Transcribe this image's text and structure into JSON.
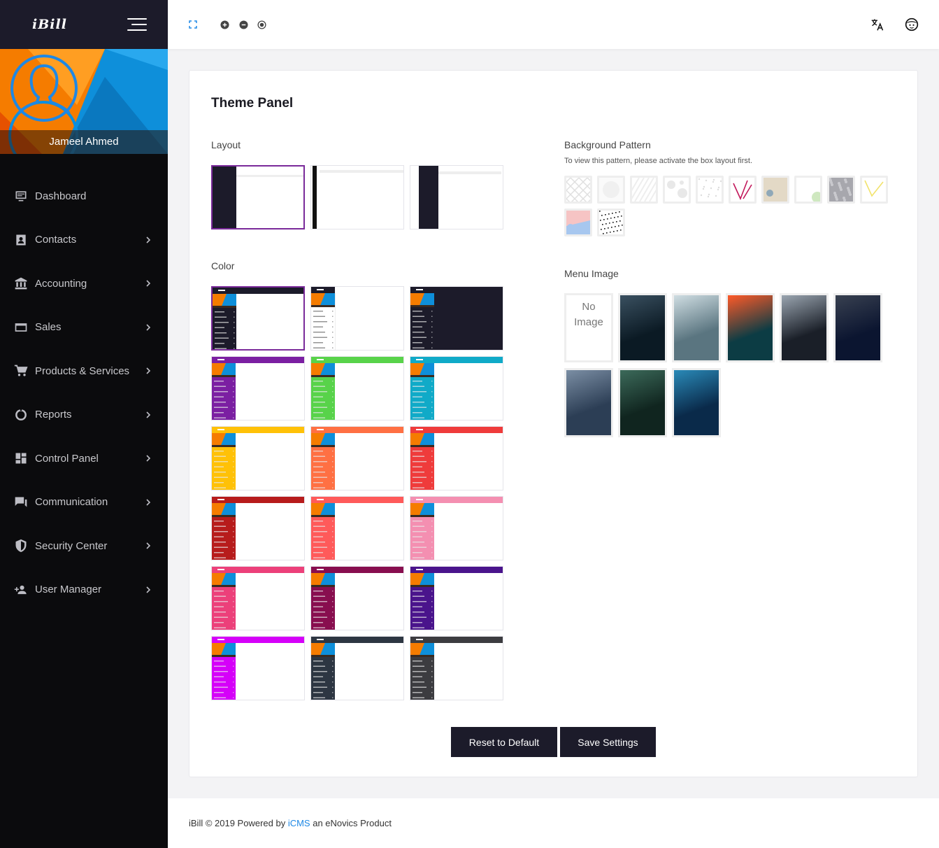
{
  "brand": {
    "logo": "iBill",
    "accent": "#1c1b2a"
  },
  "user": {
    "name": "Jameel Ahmed"
  },
  "menu": [
    {
      "label": "Dashboard",
      "icon": "dashboard-icon",
      "has_children": false
    },
    {
      "label": "Contacts",
      "icon": "contacts-icon",
      "has_children": true
    },
    {
      "label": "Accounting",
      "icon": "bank-icon",
      "has_children": true
    },
    {
      "label": "Sales",
      "icon": "credit-card-icon",
      "has_children": true
    },
    {
      "label": "Products & Services",
      "icon": "cart-icon",
      "has_children": true
    },
    {
      "label": "Reports",
      "icon": "donut-chart-icon",
      "has_children": true
    },
    {
      "label": "Control Panel",
      "icon": "grid-icon",
      "has_children": true
    },
    {
      "label": "Communication",
      "icon": "chat-icon",
      "has_children": true
    },
    {
      "label": "Security Center",
      "icon": "shield-icon",
      "has_children": true
    },
    {
      "label": "User Manager",
      "icon": "add-user-icon",
      "has_children": true
    }
  ],
  "topbar": {
    "icons": [
      "fullscreen-icon",
      "zoom-in-icon",
      "zoom-out-icon",
      "reset-zoom-icon",
      "translate-icon",
      "user-face-icon"
    ]
  },
  "panel": {
    "title": "Theme Panel",
    "layout_label": "Layout",
    "color_label": "Color",
    "bg_pattern_label": "Background Pattern",
    "bg_pattern_note": "To view this pattern, please activate the box layout first.",
    "menu_image_label": "Menu Image",
    "no_image_line1": "No",
    "no_image_line2": "Image",
    "layouts": [
      "full",
      "boxed-light",
      "boxed-dark"
    ],
    "selected_layout": 0,
    "colors": [
      {
        "name": "default",
        "header": "#1c1b2a",
        "side": "#1c1b2a",
        "content": "#ffffff",
        "type": "full"
      },
      {
        "name": "light",
        "header": "#1c1b2a",
        "side": "#ffffff",
        "content": "#ffffff",
        "type": "light"
      },
      {
        "name": "dark",
        "header": "#1c1b2a",
        "side": "#1c1b2a",
        "content": "#1c1b2a",
        "type": "dark"
      },
      {
        "name": "purple",
        "header": "#7b1fa2",
        "side": "#7b1fa2"
      },
      {
        "name": "green",
        "header": "#58d34a",
        "side": "#58d34a"
      },
      {
        "name": "cyan",
        "header": "#10aac8",
        "side": "#10aac8"
      },
      {
        "name": "amber",
        "header": "#ffc107",
        "side": "#ffc107"
      },
      {
        "name": "orange",
        "header": "#ff7043",
        "side": "#ff7043"
      },
      {
        "name": "red",
        "header": "#ef3b3b",
        "side": "#ef3b3b"
      },
      {
        "name": "dark-red",
        "header": "#b71c1c",
        "side": "#b71c1c"
      },
      {
        "name": "coral",
        "header": "#ff5a5a",
        "side": "#ff5a5a"
      },
      {
        "name": "pink",
        "header": "#f48fb1",
        "side": "#f48fb1"
      },
      {
        "name": "rose",
        "header": "#ec407a",
        "side": "#ec407a"
      },
      {
        "name": "maroon",
        "header": "#880e4f",
        "side": "#880e4f"
      },
      {
        "name": "indigo",
        "header": "#4a148c",
        "side": "#4a148c"
      },
      {
        "name": "magenta",
        "header": "#d500f9",
        "side": "#d500f9"
      },
      {
        "name": "slate",
        "header": "#2d3642",
        "side": "#2d3642"
      },
      {
        "name": "graphite",
        "header": "#3c3c40",
        "side": "#3c3c40"
      }
    ],
    "selected_color": 0,
    "patterns": [
      {
        "name": "diamond-pattern",
        "c1": "#e0e0e0",
        "c2": "#ffffff"
      },
      {
        "name": "circle-pattern",
        "c1": "#f0f0f0",
        "c2": "#fafafa"
      },
      {
        "name": "stripe-pattern",
        "c1": "#eeeeee",
        "c2": "#ffffff"
      },
      {
        "name": "blob-pattern",
        "c1": "#e8e8e8",
        "c2": "#ffffff"
      },
      {
        "name": "speck-pattern",
        "c1": "#dddddd",
        "c2": "#ffffff"
      },
      {
        "name": "line-magenta-pattern",
        "c1": "#c2185b",
        "c2": "#ffffff"
      },
      {
        "name": "beige-pattern",
        "c1": "#e3d9c6",
        "c2": "#e3d9c6"
      },
      {
        "name": "green-dot-pattern",
        "c1": "#cfe8c0",
        "c2": "#ffffff"
      },
      {
        "name": "grey-noise-pattern",
        "c1": "#a7a7ad",
        "c2": "#c9c9ce"
      },
      {
        "name": "line-yellow-pattern",
        "c1": "#f2e36b",
        "c2": "#ffffff"
      },
      {
        "name": "pink-blue-pattern",
        "c1": "#f6c4c4",
        "c2": "#a7c7ef"
      },
      {
        "name": "black-noise-pattern",
        "c1": "#222222",
        "c2": "#ffffff"
      }
    ],
    "menu_images": [
      {
        "name": "rain-dark-image",
        "c1": "#0b1a24",
        "c2": "#3a5060"
      },
      {
        "name": "forest-fog-image",
        "c1": "#5a7580",
        "c2": "#cfdde2"
      },
      {
        "name": "sunset-sea-image",
        "c1": "#0c3c44",
        "c2": "#ff5a28"
      },
      {
        "name": "city-street-image",
        "c1": "#1a1f28",
        "c2": "#9aa5b0"
      },
      {
        "name": "night-tree-image",
        "c1": "#0b1530",
        "c2": "#384050"
      },
      {
        "name": "ocean-rocks-image",
        "c1": "#2c3e55",
        "c2": "#7b8ea4"
      },
      {
        "name": "glitter-image",
        "c1": "#10251f",
        "c2": "#3c6a5a"
      },
      {
        "name": "underwater-image",
        "c1": "#0a2a4a",
        "c2": "#2a8ab8"
      }
    ],
    "reset_label": "Reset to Default",
    "save_label": "Save Settings"
  },
  "footer": {
    "prefix": "iBill © 2019 Powered by ",
    "link": "iCMS",
    "suffix": " an eNovics Product"
  }
}
